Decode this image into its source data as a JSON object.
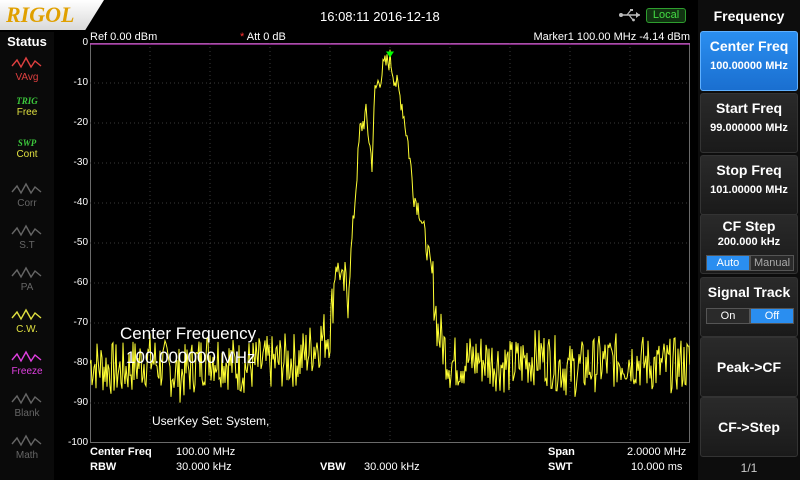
{
  "topbar": {
    "brand": "RIGOL",
    "datetime": "16:08:11 2016-12-18",
    "remote_badge": "Local"
  },
  "status": {
    "title": "Status",
    "items": [
      {
        "top": "",
        "text": "VAvg",
        "color": "#e04040"
      },
      {
        "top": "TRIG",
        "text": "Free",
        "color": "#e0e040"
      },
      {
        "top": "SWP",
        "text": "Cont",
        "color": "#e0e040"
      },
      {
        "top": "",
        "text": "Corr",
        "color": "#666666"
      },
      {
        "top": "",
        "text": "S.T",
        "color": "#666666"
      },
      {
        "top": "",
        "text": "PA",
        "color": "#666666"
      },
      {
        "top": "",
        "text": "C.W.",
        "color": "#e0e040"
      },
      {
        "top": "",
        "text": "Freeze",
        "color": "#e040e0"
      },
      {
        "top": "",
        "text": "Blank",
        "color": "#666666"
      },
      {
        "top": "",
        "text": "Math",
        "color": "#666666"
      }
    ]
  },
  "header": {
    "ref": "Ref  0.00 dBm",
    "att_star": "*",
    "att": " Att        0 dB",
    "marker": "Marker1   100.00 MHz  -4.14 dBm"
  },
  "yaxis": {
    "labels": [
      "0",
      "-10",
      "-20",
      "-30",
      "-40",
      "-50",
      "-60",
      "-70",
      "-80",
      "-90",
      "-100"
    ]
  },
  "overlay": {
    "title": "Center Frequency",
    "value": "100.000000 MHz",
    "userkey": "UserKey Set:    System,"
  },
  "bottom": {
    "center_label": "Center Freq",
    "center_value": "100.00 MHz",
    "span_label": "Span",
    "span_value": "2.0000 MHz",
    "rbw_label": "RBW",
    "rbw_value": "30.000 kHz",
    "vbw_label": "VBW",
    "vbw_value": "30.000 kHz",
    "swt_label": "SWT",
    "swt_value": "10.000 ms"
  },
  "menu": {
    "title": "Frequency",
    "center_freq": {
      "label": "Center Freq",
      "value": "100.00000 MHz"
    },
    "start_freq": {
      "label": "Start Freq",
      "value": "99.000000 MHz"
    },
    "stop_freq": {
      "label": "Stop Freq",
      "value": "101.00000 MHz"
    },
    "cf_step": {
      "label": "CF Step",
      "value": "200.000 kHz",
      "opt_auto": "Auto",
      "opt_manual": "Manual"
    },
    "signal_track": {
      "label": "Signal Track",
      "opt_on": "On",
      "opt_off": "Off"
    },
    "peak_cf": "Peak->CF",
    "cf_step_btn": "CF->Step",
    "page": "1/1"
  },
  "colors": {
    "trace": "#ffff33",
    "marker_line": "#cc44cc",
    "accent": "#2a8ef0",
    "grid": "#3a3a3a"
  },
  "chart_data": {
    "type": "line",
    "xlim": [
      99.0,
      101.0
    ],
    "ylim": [
      -100,
      0
    ],
    "x_unit": "MHz",
    "y_unit": "dBm",
    "reference_level": 0,
    "marker": {
      "x": 100.0,
      "y": -4.14
    },
    "series": [
      {
        "x": [
          99.0,
          99.1,
          99.2,
          99.3,
          99.4,
          99.5,
          99.6,
          99.7,
          99.8,
          99.82,
          99.86,
          99.9,
          99.92,
          99.94,
          99.95,
          99.96,
          99.98,
          100.0,
          100.02,
          100.04,
          100.06,
          100.08,
          100.1,
          100.12,
          100.14,
          100.16,
          100.2,
          100.3,
          100.4,
          100.5,
          100.6,
          100.7,
          100.8,
          100.9,
          101.0
        ],
        "y": [
          -80,
          -82,
          -79,
          -83,
          -78,
          -81,
          -80,
          -79,
          -72,
          -55,
          -63,
          -22,
          -18,
          -30,
          -12,
          -10,
          -6,
          -4,
          -10,
          -15,
          -25,
          -38,
          -42,
          -50,
          -58,
          -72,
          -80,
          -79,
          -81,
          -78,
          -82,
          -80,
          -79,
          -81,
          -80
        ]
      }
    ]
  }
}
